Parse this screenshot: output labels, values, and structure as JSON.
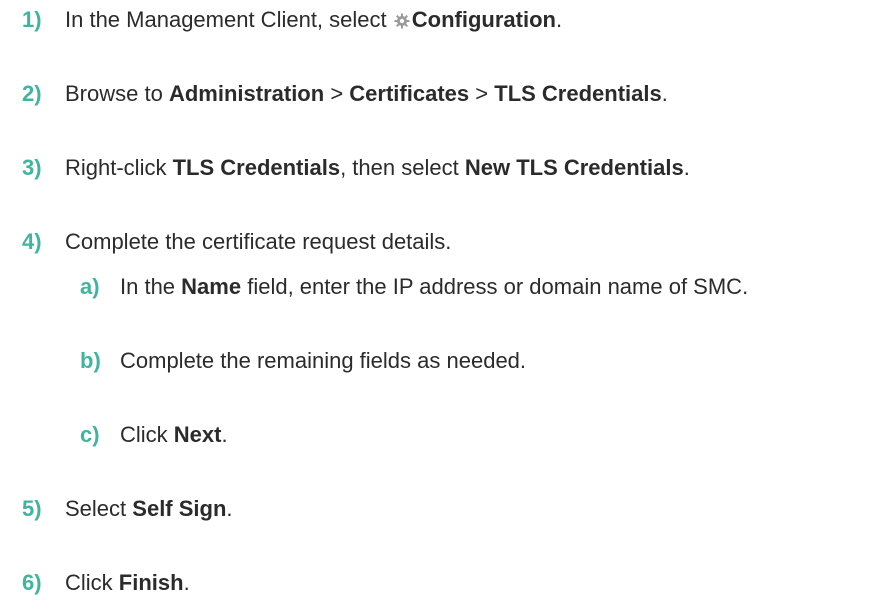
{
  "steps": [
    {
      "number": "1)",
      "text_before": "In the Management Client, select",
      "icon": "gear-icon",
      "bold": "Configuration",
      "text_after": "."
    },
    {
      "number": "2)",
      "text_1": "Browse to",
      "bold_1": "Administration",
      "sep_1": ">",
      "bold_2": "Certificates",
      "sep_2": ">",
      "bold_3": "TLS Credentials",
      "text_end": "."
    },
    {
      "number": "3)",
      "text_1": "Right-click",
      "bold_1": "TLS Credentials",
      "text_2": ", then select",
      "bold_2": "New TLS Credentials",
      "text_end": "."
    },
    {
      "number": "4)",
      "text": "Complete the certificate request details.",
      "substeps": [
        {
          "number": "a)",
          "text_1": "In the",
          "bold": "Name",
          "text_2": "field, enter the IP address or domain name of SMC."
        },
        {
          "number": "b)",
          "text": "Complete the remaining fields as needed."
        },
        {
          "number": "c)",
          "text_1": "Click",
          "bold": "Next",
          "text_end": "."
        }
      ]
    },
    {
      "number": "5)",
      "text_1": "Select",
      "bold": "Self Sign",
      "text_end": "."
    },
    {
      "number": "6)",
      "text_1": "Click",
      "bold": "Finish",
      "text_end": "."
    }
  ],
  "colors": {
    "step_number": "#3fb5a0",
    "text": "#2b2b2b",
    "icon": "#9a9a9a"
  }
}
